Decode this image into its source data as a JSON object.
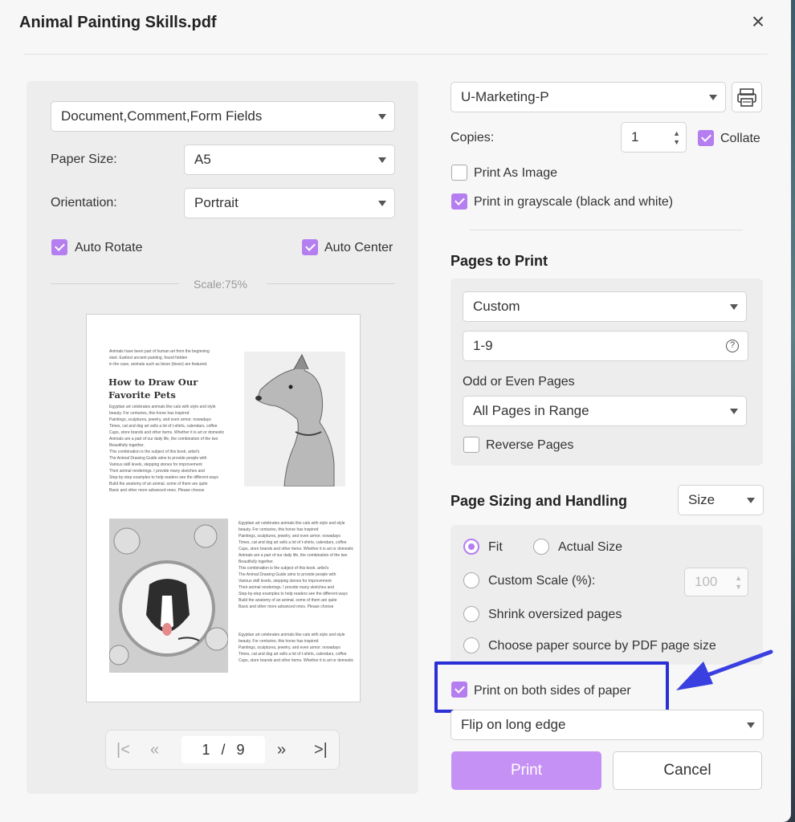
{
  "window": {
    "title": "Animal Painting Skills.pdf"
  },
  "left": {
    "content_select": "Document,Comment,Form Fields",
    "paper_size_label": "Paper Size:",
    "paper_size_value": "A5",
    "orientation_label": "Orientation:",
    "orientation_value": "Portrait",
    "auto_rotate_label": "Auto Rotate",
    "auto_center_label": "Auto Center",
    "scale_text": "Scale:75%",
    "pager": {
      "current": "1",
      "separator": "/",
      "total": "9"
    }
  },
  "preview_page": {
    "intro": [
      "Animals have been part of human art from the beginning",
      "start. Earliest ancient painting, found hidden",
      "in the cave, animals such as bison (bison) are featured."
    ],
    "heading1": "How to Draw Our",
    "heading2": "Favorite Pets",
    "para1": [
      "Egyptian art celebrates animals like cats with style and style",
      "beauty. For centuries, this horse has inspired",
      "Paintings, sculptures, jewelry, and even armor. nowadays",
      "Times, cat and dog art sells a lot of t-shirts, calendars, coffee",
      "Cups, store brands and other items. Whether it is art or domestic",
      "Animals are a part of our daily life, the combination of the two",
      "Beautifully together.",
      "This combination is the subject of this book. artist's",
      "The Animal Drawing Guide aims to provide people with",
      "Various skill levels, stepping stones for improvement",
      "Their animal renderings. I provide many sketches and",
      "Step-by-step examples to help readers see the different ways",
      "Build the anatomy of an animal. some of them are quite",
      "Basic and other more advanced ones. Please choose"
    ],
    "para2": [
      "Egyptian art celebrates animals like cats with style and style",
      "beauty. For centuries, this horse has inspired",
      "Paintings, sculptures, jewelry, and even armor. nowadays",
      "Times, cat and dog art sells a lot of t-shirts, calendars, coffee",
      "Cups, store brands and other items. Whether it is art or domestic",
      "Animals are a part of our daily life, the combination of the two",
      "Beautifully together.",
      "This combination is the subject of this book. artist's",
      "The Animal Drawing Guide aims to provide people with",
      "Various skill levels, stepping stones for improvement",
      "Their animal renderings. I provide many sketches and",
      "Step-by-step examples to help readers see the different ways",
      "Build the anatomy of an animal. some of them are quite",
      "Basic and other more advanced ones. Please choose"
    ],
    "para3": [
      "Egyptian art celebrates animals like cats with style and style",
      "beauty. For centuries, this horse has inspired",
      "Paintings, sculptures, jewelry, and even armor. nowadays",
      "Times, cat and dog art sells a lot of t-shirts, calendars, coffee",
      "Cups, store brands and other items. Whether it is art or domestic"
    ]
  },
  "right": {
    "printer": "U-Marketing-P",
    "copies_label": "Copies:",
    "copies_value": "1",
    "collate_label": "Collate",
    "print_as_image_label": "Print As Image",
    "grayscale_label": "Print in grayscale (black and white)",
    "pages_title": "Pages to Print",
    "pages_mode": "Custom",
    "pages_range": "1-9",
    "odd_even_label": "Odd or Even Pages",
    "odd_even_value": "All Pages in Range",
    "reverse_label": "Reverse Pages",
    "sizing_title": "Page Sizing and Handling",
    "sizing_select": "Size",
    "fit_label": "Fit",
    "actual_size_label": "Actual Size",
    "custom_scale_label": "Custom Scale (%):",
    "custom_scale_value": "100",
    "shrink_label": "Shrink oversized pages",
    "paper_source_label": "Choose paper source by PDF page size",
    "both_sides_label": "Print on both sides of paper",
    "flip_value": "Flip on long edge",
    "print_button": "Print",
    "cancel_button": "Cancel"
  },
  "colors": {
    "accent": "#b57ef0",
    "highlight": "#2b2fd6"
  }
}
